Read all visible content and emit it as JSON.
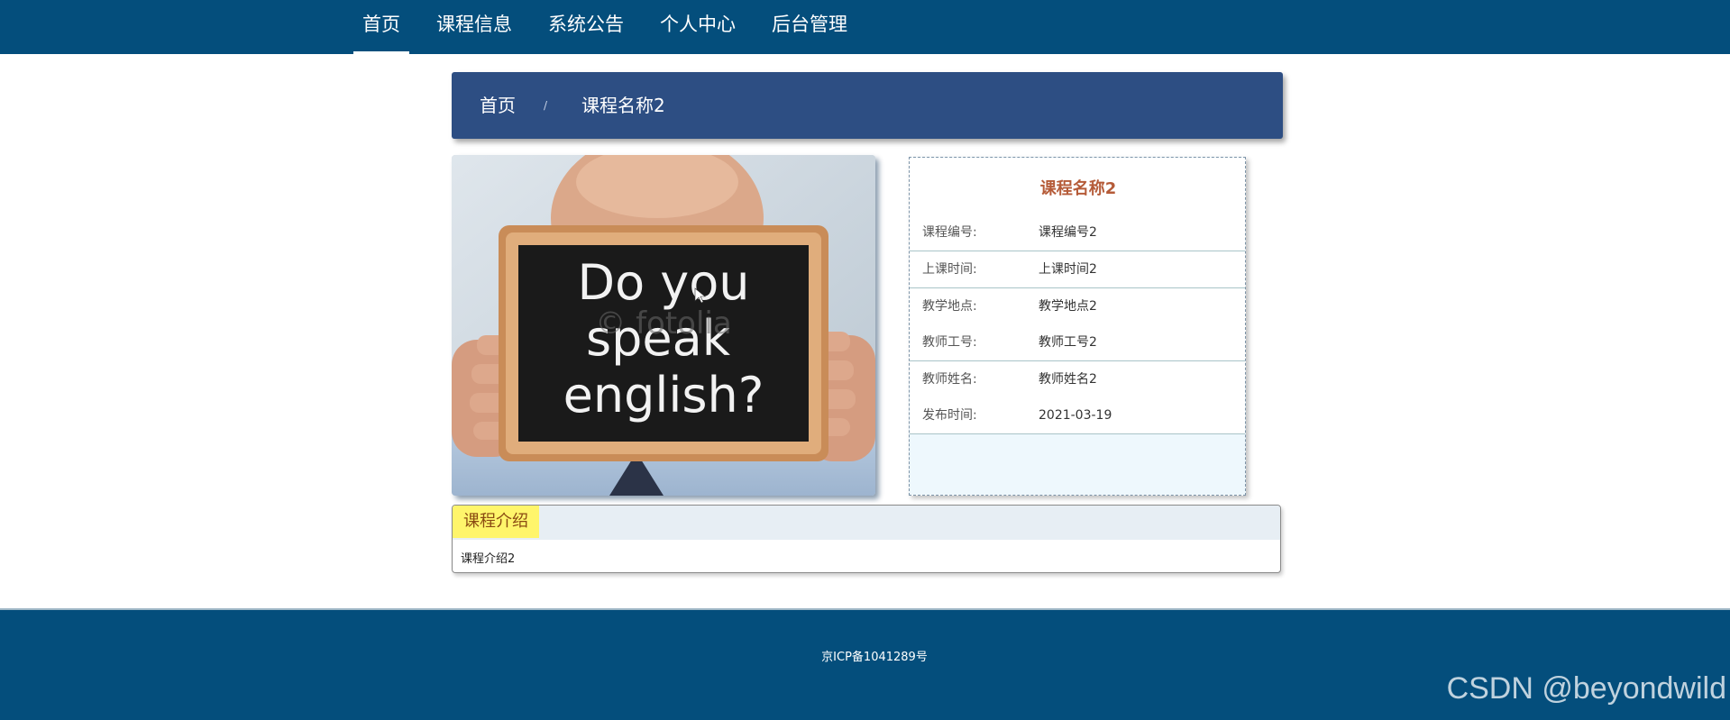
{
  "nav": {
    "items": [
      {
        "label": "首页",
        "active": true
      },
      {
        "label": "课程信息",
        "active": false
      },
      {
        "label": "系统公告",
        "active": false
      },
      {
        "label": "个人中心",
        "active": false
      },
      {
        "label": "后台管理",
        "active": false
      }
    ]
  },
  "breadcrumb": {
    "home": "首页",
    "separator": "/",
    "current": "课程名称2"
  },
  "course_image": {
    "text_line1": "Do you",
    "text_line2": "speak",
    "text_line3": "english?",
    "watermark": "© fotolia"
  },
  "detail": {
    "title": "课程名称2",
    "rows": [
      {
        "label": "课程编号:",
        "value": "课程编号2"
      },
      {
        "label": "上课时间:",
        "value": "上课时间2"
      },
      {
        "label": "教学地点:",
        "value": "教学地点2"
      },
      {
        "label": "教师工号:",
        "value": "教师工号2"
      },
      {
        "label": "教师姓名:",
        "value": "教师姓名2"
      },
      {
        "label": "发布时间:",
        "value": "2021-03-19"
      }
    ]
  },
  "intro": {
    "tab_label": "课程介绍",
    "content": "课程介绍2"
  },
  "footer": {
    "icp": "京ICP备1041289号",
    "watermark": "CSDN @beyondwild"
  },
  "colors": {
    "header": "#044e7c",
    "breadcrumb": "#2d4e83",
    "title_accent": "#b55b38",
    "tab_highlight": "#fff56b"
  }
}
